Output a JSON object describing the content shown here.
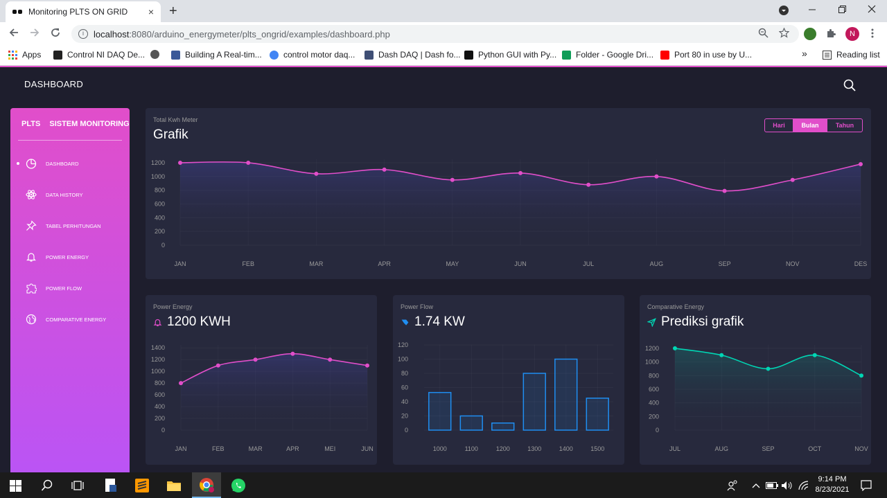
{
  "browser": {
    "tab_title": "Monitoring PLTS ON GRID",
    "tab_close": "×",
    "new_tab": "+",
    "url_host": "localhost",
    "url_path": ":8080/arduino_energymeter/plts_ongrid/examples/dashboard.php",
    "profile_initial": "N",
    "bookmarks": [
      {
        "label": "Apps",
        "color": "#e94235"
      },
      {
        "label": "Control NI DAQ De...",
        "color": "#222222"
      },
      {
        "label": "",
        "color": "#555555"
      },
      {
        "label": "Building A Real-tim...",
        "color": "#3b5998"
      },
      {
        "label": "control motor daq...",
        "color": "#4285f4"
      },
      {
        "label": "Dash DAQ | Dash fo...",
        "color": "#3f4f75"
      },
      {
        "label": "Python GUI with Py...",
        "color": "#111111"
      },
      {
        "label": "Folder - Google Dri...",
        "color": "#0f9d58"
      },
      {
        "label": "Port 80 in use by U...",
        "color": "#ff0000"
      }
    ],
    "more_bookmarks": "»",
    "reading_list": "Reading list"
  },
  "header": {
    "brand": "DASHBOARD"
  },
  "sidebar": {
    "logo_mini": "PLTS",
    "logo_normal": "SISTEM MONITORING",
    "items": [
      {
        "label": "DASHBOARD",
        "icon": "chart-pie-icon",
        "active": true
      },
      {
        "label": "DATA HISTORY",
        "icon": "atom-icon",
        "active": false
      },
      {
        "label": "TABEL PERHITUNGAN",
        "icon": "pin-icon",
        "active": false
      },
      {
        "label": "POWER ENERGY",
        "icon": "bell-icon",
        "active": false
      },
      {
        "label": "POWER FLOW",
        "icon": "puzzle-icon",
        "active": false
      },
      {
        "label": "COMPARATIVE ENERGY",
        "icon": "world-icon",
        "active": false
      }
    ]
  },
  "big_chart": {
    "category": "Total Kwh Meter",
    "title": "Grafik",
    "buttons": [
      "Hari",
      "Bulan",
      "Tahun"
    ],
    "active_button": "Bulan"
  },
  "power_energy": {
    "category": "Power Energy",
    "title": "1200 KWH"
  },
  "power_flow": {
    "category": "Power Flow",
    "title": "1.74 KW"
  },
  "comparative": {
    "category": "Comparative Energy",
    "title": "Prediksi grafik"
  },
  "taskbar": {
    "time": "9:14 PM",
    "date": "8/23/2021"
  },
  "colors": {
    "accent": "#e14eca",
    "blue": "#1f8ef1",
    "teal": "#00d6b4",
    "card": "#27293d",
    "bg": "#1e1e2d"
  },
  "chart_data": [
    {
      "type": "line",
      "categories": [
        "JAN",
        "FEB",
        "MAR",
        "APR",
        "MAY",
        "JUN",
        "JUL",
        "AUG",
        "SEP",
        "NOV",
        "DES"
      ],
      "values": [
        1200,
        1200,
        1040,
        1100,
        950,
        1050,
        880,
        1000,
        790,
        950,
        1180
      ],
      "yticks": [
        0,
        200,
        400,
        600,
        800,
        1000,
        1200
      ],
      "ylim": [
        0,
        1250
      ],
      "color": "#e14eca"
    },
    {
      "type": "line",
      "categories": [
        "JAN",
        "FEB",
        "MAR",
        "APR",
        "MEI",
        "JUN"
      ],
      "values": [
        800,
        1100,
        1200,
        1300,
        1200,
        1100
      ],
      "yticks": [
        0,
        200,
        400,
        600,
        800,
        1000,
        1200,
        1400
      ],
      "ylim": [
        0,
        1450
      ],
      "color": "#e14eca"
    },
    {
      "type": "bar",
      "categories": [
        "1000",
        "1100",
        "1200",
        "1300",
        "1400",
        "1500"
      ],
      "values": [
        53,
        20,
        10,
        80,
        100,
        45
      ],
      "yticks": [
        0,
        20,
        40,
        60,
        80,
        100,
        120
      ],
      "ylim": [
        0,
        120
      ],
      "color": "#1f8ef1"
    },
    {
      "type": "line",
      "categories": [
        "JUL",
        "AUG",
        "SEP",
        "OCT",
        "NOV"
      ],
      "values": [
        1200,
        1100,
        900,
        1100,
        800
      ],
      "yticks": [
        0,
        200,
        400,
        600,
        800,
        1000,
        1200
      ],
      "ylim": [
        0,
        1250
      ],
      "color": "#00d6b4"
    }
  ]
}
